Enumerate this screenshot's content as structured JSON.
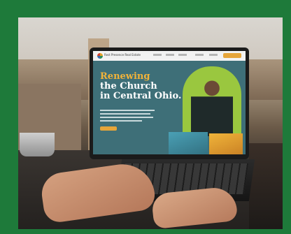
{
  "colors": {
    "border_green": "#1e7a3a",
    "site_teal": "#3e6f78",
    "accent_gold": "#f1b33a",
    "accent_lime": "#9ac73f"
  },
  "screen": {
    "brand": "Rest Presence Real Estate",
    "headline_line1": "Renewing",
    "headline_line2": "the Church",
    "headline_line3": "in Central Ohio."
  }
}
